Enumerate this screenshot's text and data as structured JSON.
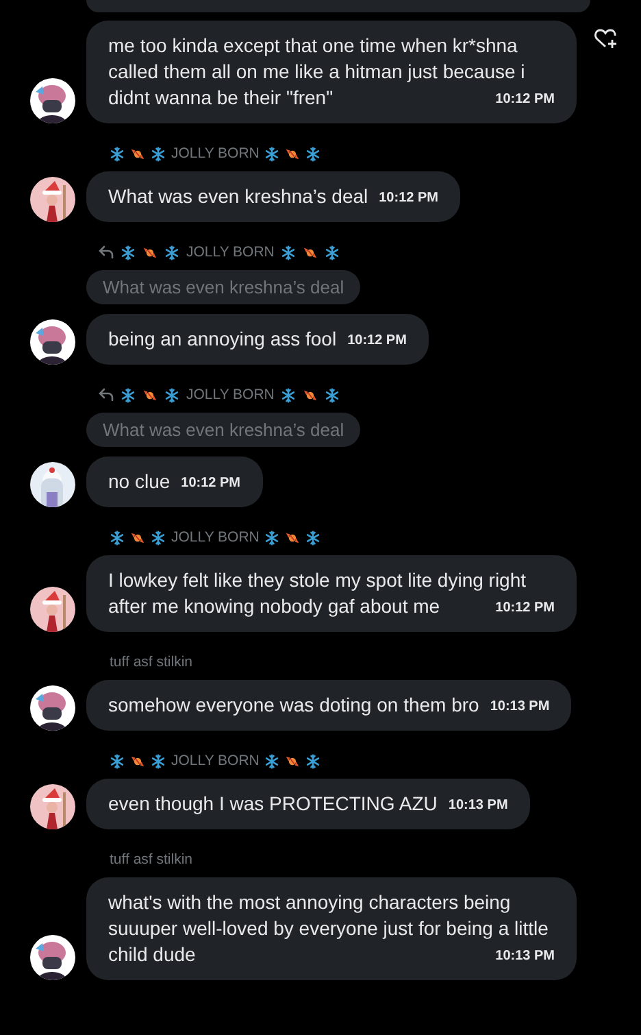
{
  "messages": [
    {
      "avatar": {
        "kind": "pink-hair"
      },
      "text": "me too kinda except that one time when kr*shna called them all on me like a hitman just because i didnt wanna be their \"fren\"",
      "time": "10:12 PM",
      "reaction_button": true
    },
    {
      "sender": {
        "name": "JOLLY BORN",
        "decorated": true
      },
      "avatar": {
        "kind": "santa"
      },
      "text": "What was even kreshna’s deal",
      "time": "10:12 PM"
    },
    {
      "reply": {
        "name": "JOLLY BORN",
        "decorated": true,
        "quote": "What was even kreshna’s deal"
      },
      "avatar": {
        "kind": "pink-hair"
      },
      "text": "being an annoying ass fool",
      "time": "10:12 PM"
    },
    {
      "reply": {
        "name": "JOLLY BORN",
        "decorated": true,
        "quote": "What was even kreshna’s deal"
      },
      "avatar": {
        "kind": "white-hair"
      },
      "text": "no clue",
      "time": "10:12 PM"
    },
    {
      "sender": {
        "name": "JOLLY BORN",
        "decorated": true
      },
      "avatar": {
        "kind": "santa"
      },
      "text": "I lowkey felt like they stole my spot lite dying right after me knowing nobody gaf about me",
      "time": "10:12 PM"
    },
    {
      "sender": {
        "name": "tuff asf stilkin",
        "decorated": false
      },
      "avatar": {
        "kind": "pink-hair"
      },
      "text": "somehow everyone was doting on them bro",
      "time": "10:13 PM"
    },
    {
      "sender": {
        "name": "JOLLY BORN",
        "decorated": true
      },
      "avatar": {
        "kind": "santa"
      },
      "text": "even though I was PROTECTING AZU",
      "time": "10:13 PM"
    },
    {
      "sender": {
        "name": "tuff asf stilkin",
        "decorated": false
      },
      "avatar": {
        "kind": "pink-hair"
      },
      "text": "what's with the most annoying characters being suuuper well-loved by everyone just for being a little child dude",
      "time": "10:13 PM"
    }
  ]
}
